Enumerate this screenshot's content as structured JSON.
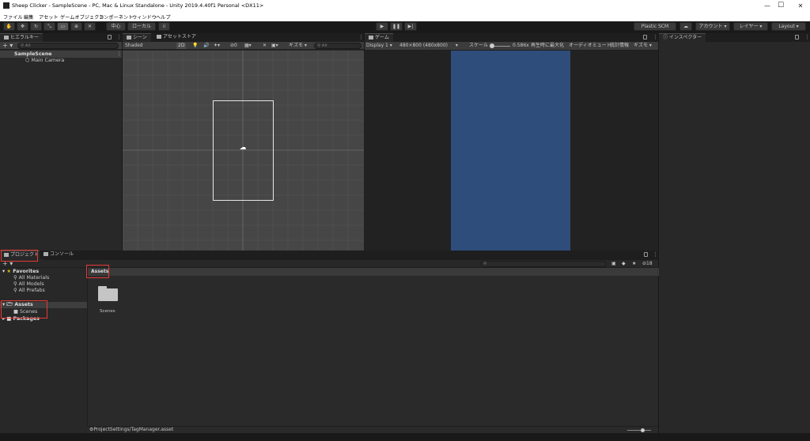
{
  "window": {
    "title": "Sheep Clicker - SampleScene - PC, Mac & Linux Standalone - Unity 2019.4.40f1 Personal <DX11>",
    "minimize": "—",
    "maximize": "☐",
    "close": "✕"
  },
  "menubar": [
    "ファイル",
    "編集",
    "アセット",
    "ゲームオブジェクト",
    "コンポーネント",
    "ウィンドウ",
    "ヘルプ"
  ],
  "toolbar": {
    "pivot_center": "中心",
    "pivot_local": "ローカル",
    "plastic_scm": "Plastic SCM",
    "account": "アカウント",
    "layers": "レイヤー",
    "layout": "Layout"
  },
  "hierarchy": {
    "tab": "ヒエラルキー",
    "search_placeholder": "All",
    "scene": "SampleScene",
    "items": [
      "Main Camera"
    ]
  },
  "scene": {
    "tab_scene": "シーン",
    "tab_asset_store": "アセットストア",
    "shading": "Shaded",
    "mode_2d": "2D",
    "hidden_count": "0",
    "gizmos": "ギズモ",
    "search_placeholder": "All"
  },
  "game": {
    "tab": "ゲーム",
    "display": "Display 1",
    "resolution": "480×800 (480x800)",
    "scale_label": "スケール",
    "scale_value": "0.586x",
    "maximize_on_play": "再生時に最大化",
    "mute_audio": "オーディオミュート",
    "stats": "統計情報",
    "gizmos": "ギズモ"
  },
  "inspector": {
    "tab": "インスペクター"
  },
  "project": {
    "tab_project": "プロジェクト",
    "tab_console": "コンソール",
    "hidden_count": "18",
    "favorites_label": "Favorites",
    "favorites": [
      "All Materials",
      "All Models",
      "All Prefabs"
    ],
    "assets_label": "Assets",
    "asset_children": [
      "Scenes"
    ],
    "packages_label": "Packages",
    "breadcrumb": "Assets",
    "grid_items": [
      "Scenes"
    ],
    "selected_path": "ProjectSettings/TagManager.asset"
  },
  "colors": {
    "highlight_box": "#e53935",
    "game_background": "#2e4d7a",
    "favorites_star": "#e2b714"
  }
}
